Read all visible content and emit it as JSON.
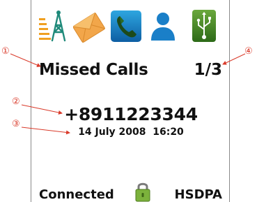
{
  "header_icons": [
    {
      "name": "signal-tower-icon"
    },
    {
      "name": "envelope-icon"
    },
    {
      "name": "phone-icon"
    },
    {
      "name": "contact-icon"
    },
    {
      "name": "usb-icon"
    }
  ],
  "screen": {
    "title": "Missed Calls",
    "page_indicator": "1/3",
    "phone_number": "+8911223344",
    "datetime": "14 July 2008  16:20"
  },
  "status_bar": {
    "connection": "Connected",
    "network": "HSDPA",
    "lock_icon": "padlock-icon"
  },
  "callouts": {
    "c1": "①",
    "c2": "②",
    "c3": "③",
    "c4": "④"
  },
  "colors": {
    "callout": "#d93a2a",
    "phone_icon_bg": "#1585c6",
    "contact_icon": "#1a7fc8",
    "usb_icon_bg": "#4b8a2a",
    "signal_orange": "#f0a021",
    "envelope": "#f2a64a"
  }
}
